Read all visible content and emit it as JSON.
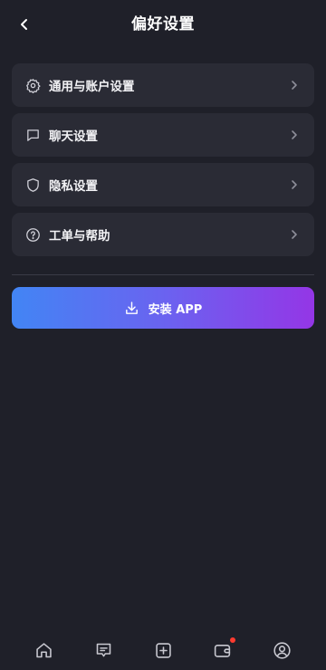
{
  "header": {
    "title": "偏好设置",
    "back_icon": "chevron-left-icon"
  },
  "menu": {
    "items": [
      {
        "label": "通用与账户设置",
        "icon": "gear-icon"
      },
      {
        "label": "聊天设置",
        "icon": "chat-bubble-icon"
      },
      {
        "label": "隐私设置",
        "icon": "shield-icon"
      },
      {
        "label": "工单与帮助",
        "icon": "help-circle-icon"
      }
    ]
  },
  "install_button": {
    "label": "安装 APP",
    "icon": "download-icon",
    "gradient": [
      "#4285f4",
      "#9436e6"
    ]
  },
  "tabbar": {
    "items": [
      {
        "icon": "home-icon"
      },
      {
        "icon": "message-icon"
      },
      {
        "icon": "plus-square-icon"
      },
      {
        "icon": "wallet-icon",
        "has_badge": true
      },
      {
        "icon": "profile-icon"
      }
    ],
    "badge_color": "#ff3b30"
  },
  "colors": {
    "background": "#1f2029",
    "card": "#2a2b35",
    "text": "#ffffff"
  }
}
